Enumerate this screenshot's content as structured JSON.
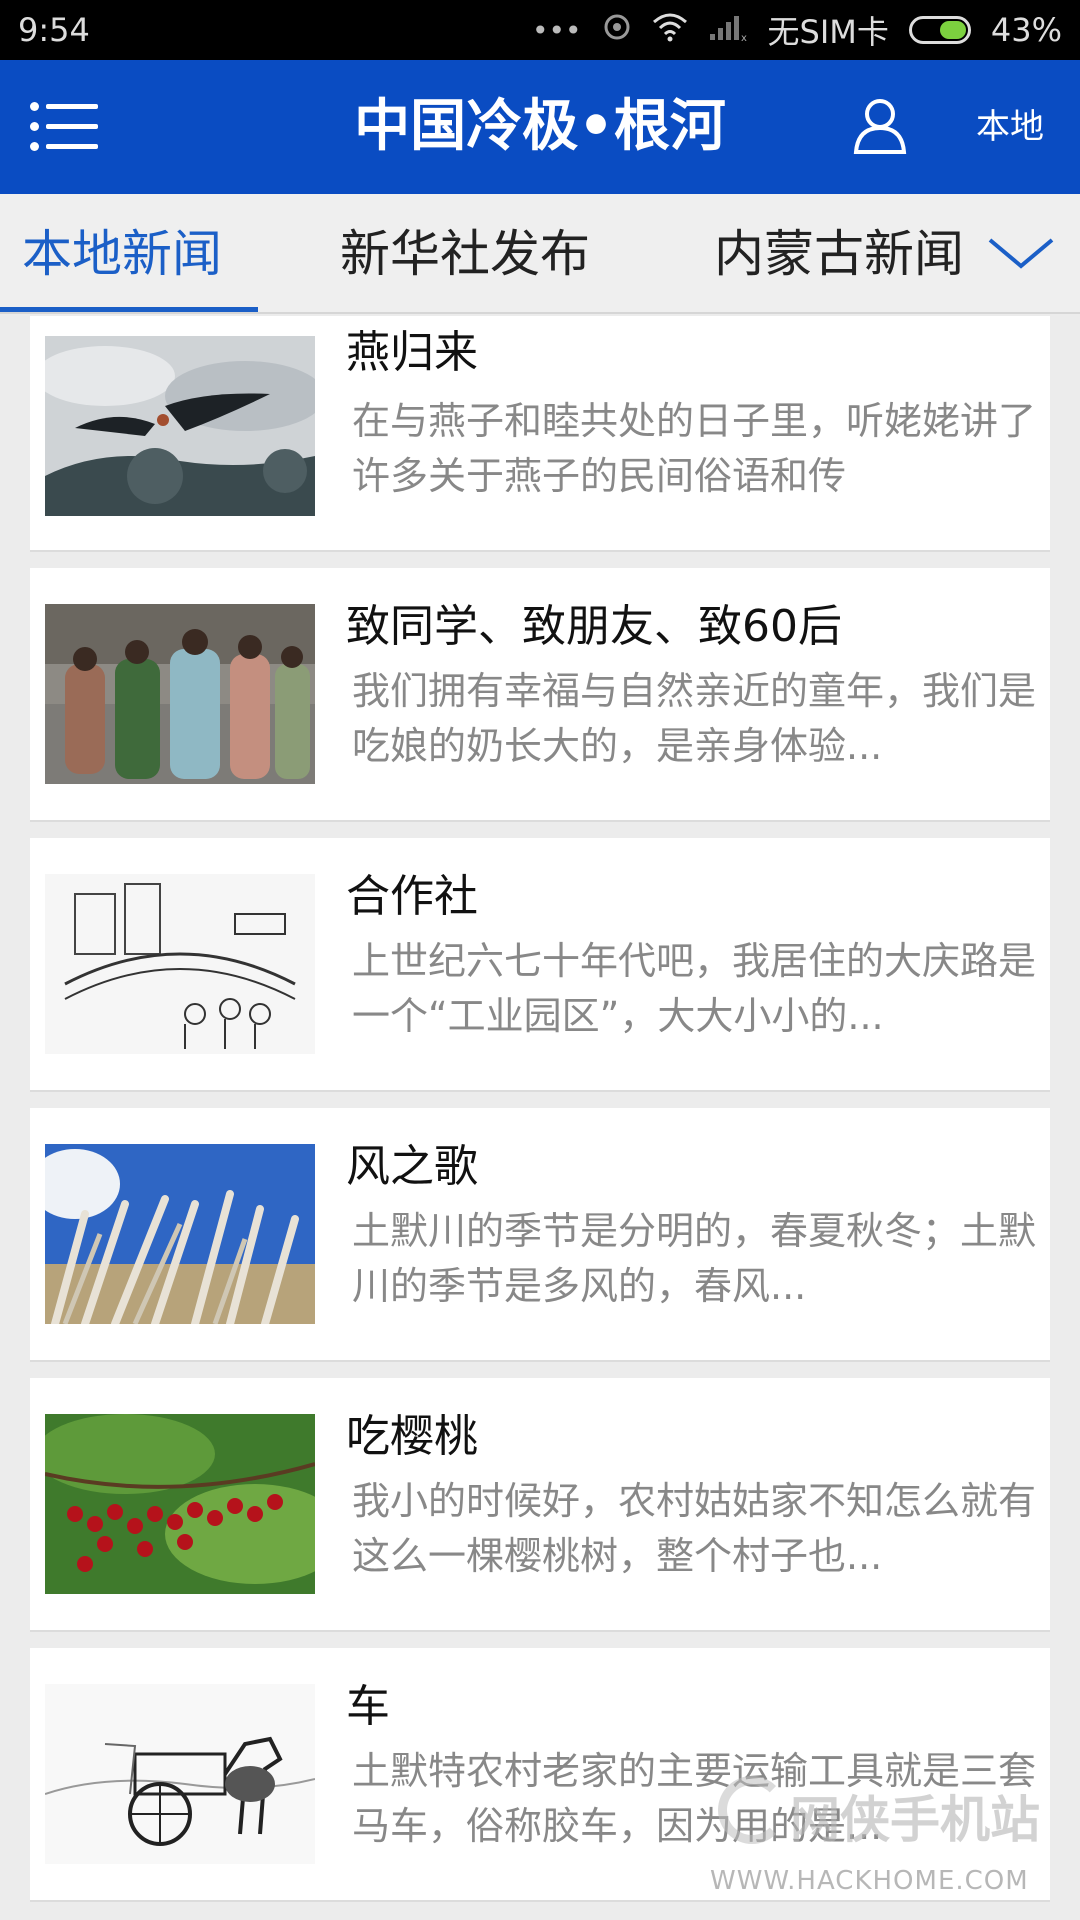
{
  "status_bar": {
    "time": "9:54",
    "sim_text": "无SIM卡",
    "battery_percent": "43%",
    "battery_level": 0.43,
    "icons": [
      "more-dots-icon",
      "hotspot-icon",
      "wifi-icon",
      "signal-icon",
      "battery-icon"
    ]
  },
  "header": {
    "title": "中国冷极•根河",
    "local_label": "本地",
    "accent_color": "#0a4cc2"
  },
  "tabs": {
    "items": [
      {
        "label": "本地新闻",
        "active": true
      },
      {
        "label": "新华社发布",
        "active": false
      },
      {
        "label": "内蒙古新闻",
        "active": false
      }
    ],
    "active_color": "#1b5fc7"
  },
  "news": [
    {
      "title": "燕归来",
      "summary": "在与燕子和睦共处的日子里，听姥姥讲了许多关于燕子的民间俗语和传",
      "thumb": "swallows-image"
    },
    {
      "title": "致同学、致朋友、致60后",
      "summary": "我们拥有幸福与自然亲近的童年，我们是吃娘的奶长大的，是亲身体验...",
      "thumb": "old-photo-people-image"
    },
    {
      "title": "合作社",
      "summary": "上世纪六七十年代吧，我居住的大庆路是一个“工业园区”，大大小小的...",
      "thumb": "cooperative-sketch-image"
    },
    {
      "title": "风之歌",
      "summary": "土默川的季节是分明的，春夏秋冬；土默川的季节是多风的，春风...",
      "thumb": "reeds-sky-image"
    },
    {
      "title": "吃樱桃",
      "summary": "我小的时候好，农村姑姑家不知怎么就有这么一棵樱桃树，整个村子也...",
      "thumb": "cherries-image"
    },
    {
      "title": "车",
      "summary": "土默特农村老家的主要运输工具就是三套马车，俗称胶车，因为用的是...",
      "thumb": "horse-cart-sketch-image"
    }
  ],
  "watermark": {
    "cn": "网侠手机站",
    "en": "WWW.HACKHOME.COM"
  }
}
